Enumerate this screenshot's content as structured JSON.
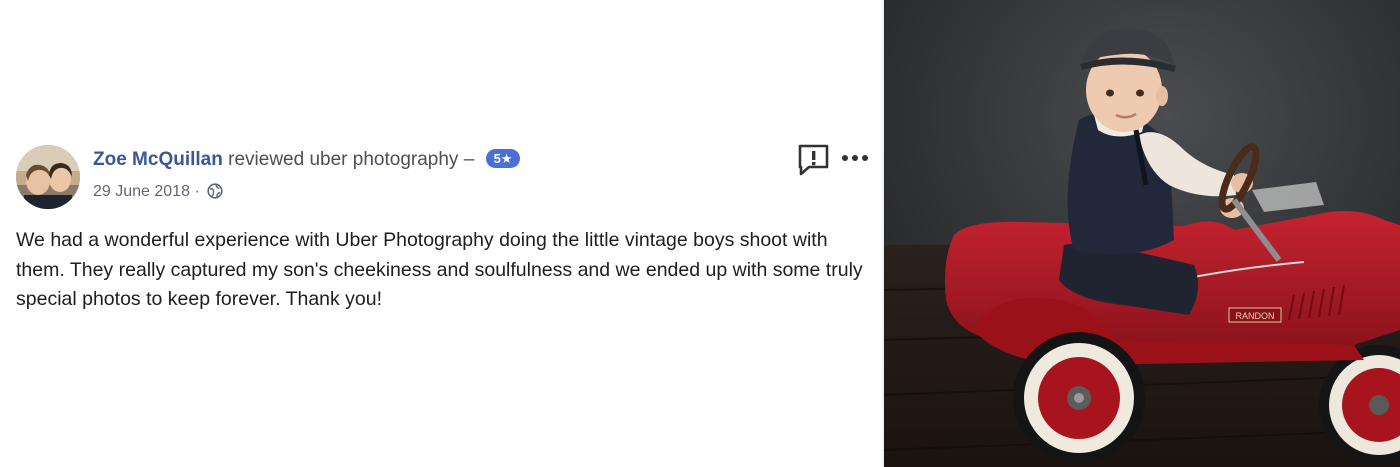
{
  "review": {
    "author": "Zoe McQuillan",
    "action": "reviewed",
    "page_name": "uber photography",
    "separator": "–",
    "rating_badge": "5★",
    "date": "29 June 2018",
    "date_separator": "·",
    "privacy_icon": "globe-icon",
    "text": "We had a wonderful experience with Uber Photography doing the little vintage boys shoot with them. They really captured my son's cheekiness and soulfulness and we ended up with some truly special photos to keep forever. Thank you!",
    "report_icon": "report-icon",
    "more_icon": "more-options-icon"
  },
  "photo": {
    "car_plate": "RANDON"
  },
  "colors": {
    "author": "#385898",
    "badge": "#4a6fd6",
    "body_text": "#1c1e21",
    "meta_text": "#616770",
    "car_red": "#b01a24"
  }
}
